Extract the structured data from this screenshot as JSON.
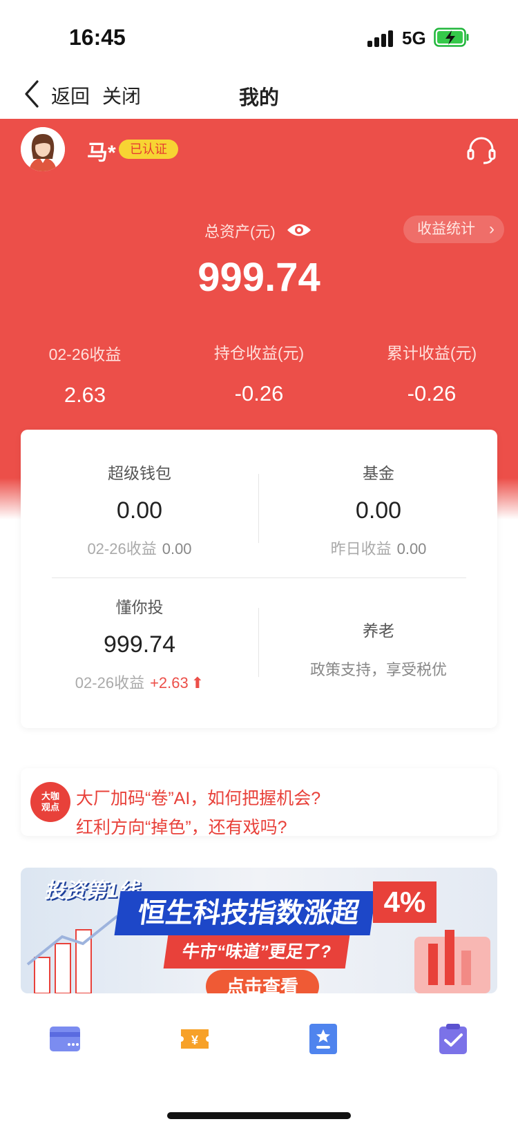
{
  "status_bar": {
    "time": "16:45",
    "network": "5G"
  },
  "nav": {
    "back_label": "返回",
    "close_label": "关闭",
    "title": "我的"
  },
  "profile": {
    "username": "马*",
    "verified_badge": "已认证"
  },
  "summary": {
    "total_assets_label": "总资产(元)",
    "total_assets_value": "999.74",
    "earnings_stats_label": "收益统计",
    "stats": [
      {
        "label": "02-26收益",
        "value": "2.63"
      },
      {
        "label": "持仓收益(元)",
        "value": "-0.26"
      },
      {
        "label": "累计收益(元)",
        "value": "-0.26"
      }
    ]
  },
  "products": {
    "super_wallet": {
      "title": "超级钱包",
      "value": "0.00",
      "sub_label": "02-26收益",
      "sub_value": "0.00"
    },
    "fund": {
      "title": "基金",
      "value": "0.00",
      "sub_label": "昨日收益",
      "sub_value": "0.00"
    },
    "smart_invest": {
      "title": "懂你投",
      "value": "999.74",
      "sub_label": "02-26收益",
      "sub_value": "+2.63"
    },
    "pension": {
      "title": "养老",
      "desc": "政策支持，享受税优"
    }
  },
  "news": {
    "icon_text_1": "大咖",
    "icon_text_2": "观点",
    "line1": "大厂加码“卷”AI，如何把握机会?",
    "line2": "红利方向“掉色”，还有戏吗?"
  },
  "banner": {
    "tag": "投资第1线",
    "headline": "恒生科技指数涨超",
    "percent": "4%",
    "subline": "牛市“味道”更足了?",
    "button": "点击查看"
  },
  "colors": {
    "brand_red": "#ec4f49",
    "badge_yellow": "#f7d433",
    "banner_blue": "#1d47c8"
  },
  "tab_icons": [
    "card-icon",
    "coupon-icon",
    "star-doc-icon",
    "clipboard-check-icon"
  ]
}
